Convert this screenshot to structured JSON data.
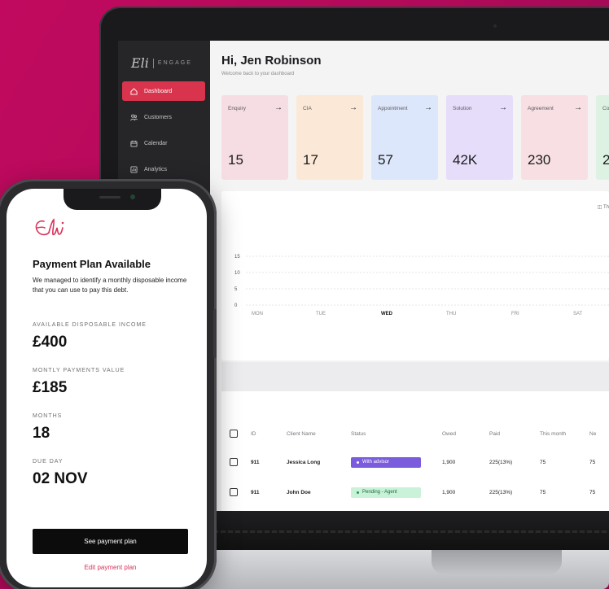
{
  "colors": {
    "background": "#c10a5f",
    "accent": "#d9344d",
    "purple": "#7a5cdc",
    "green_bg": "#c9f2d8"
  },
  "dashboard": {
    "logo_script": "Eli",
    "logo_engage": "ENGAGE",
    "nav": [
      {
        "label": "Dashboard",
        "icon": "home-icon"
      },
      {
        "label": "Customers",
        "icon": "users-icon"
      },
      {
        "label": "Calendar",
        "icon": "calendar-icon"
      },
      {
        "label": "Analytics",
        "icon": "analytics-icon"
      }
    ],
    "greeting": "Hi, Jen Robinson",
    "subgreeting": "Welcome back to your dashboard",
    "cards": [
      {
        "label": "Enquiry",
        "value": "15",
        "color": "#f6dde3"
      },
      {
        "label": "CIA",
        "value": "17",
        "color": "#fbe8d6"
      },
      {
        "label": "Appointment",
        "value": "57",
        "color": "#dde7fb"
      },
      {
        "label": "Solution",
        "value": "42K",
        "color": "#e6ddfb"
      },
      {
        "label": "Agreement",
        "value": "230",
        "color": "#f7dfe3"
      },
      {
        "label": "Co",
        "value": "2",
        "color": "#def2e3"
      }
    ],
    "chart_filter": "Th",
    "chart": {
      "y_ticks": [
        "15",
        "10",
        "5",
        "0"
      ],
      "days": [
        "MON",
        "TUE",
        "WED",
        "THU",
        "FRI",
        "SAT"
      ],
      "active_day": "WED"
    },
    "table": {
      "headers": [
        "ID",
        "Client Name",
        "Status",
        "Owed",
        "Paid",
        "This month",
        "Ne"
      ],
      "rows": [
        {
          "id": "911",
          "name": "Jessica Long",
          "status": "With advisor",
          "owed": "1,900",
          "paid": "225(13%)",
          "this_month": "75",
          "next": "75"
        },
        {
          "id": "911",
          "name": "John Doe",
          "status": "Pending - Agent",
          "owed": "1,900",
          "paid": "225(13%)",
          "this_month": "75",
          "next": "75"
        }
      ]
    }
  },
  "phone": {
    "title": "Payment Plan Available",
    "description": "We managed to identify a monthly disposable income that you can use to pay this debt.",
    "fields": [
      {
        "label": "AVAILABLE DISPOSABLE INCOME",
        "value": "£400"
      },
      {
        "label": "MONTLY PAYMENTS VALUE",
        "value": "£185"
      },
      {
        "label": "MONTHS",
        "value": "18"
      },
      {
        "label": "DUE DAY",
        "value": "02 NOV"
      }
    ],
    "primary_button": "See payment plan",
    "secondary_link": "Edit payment plan"
  }
}
